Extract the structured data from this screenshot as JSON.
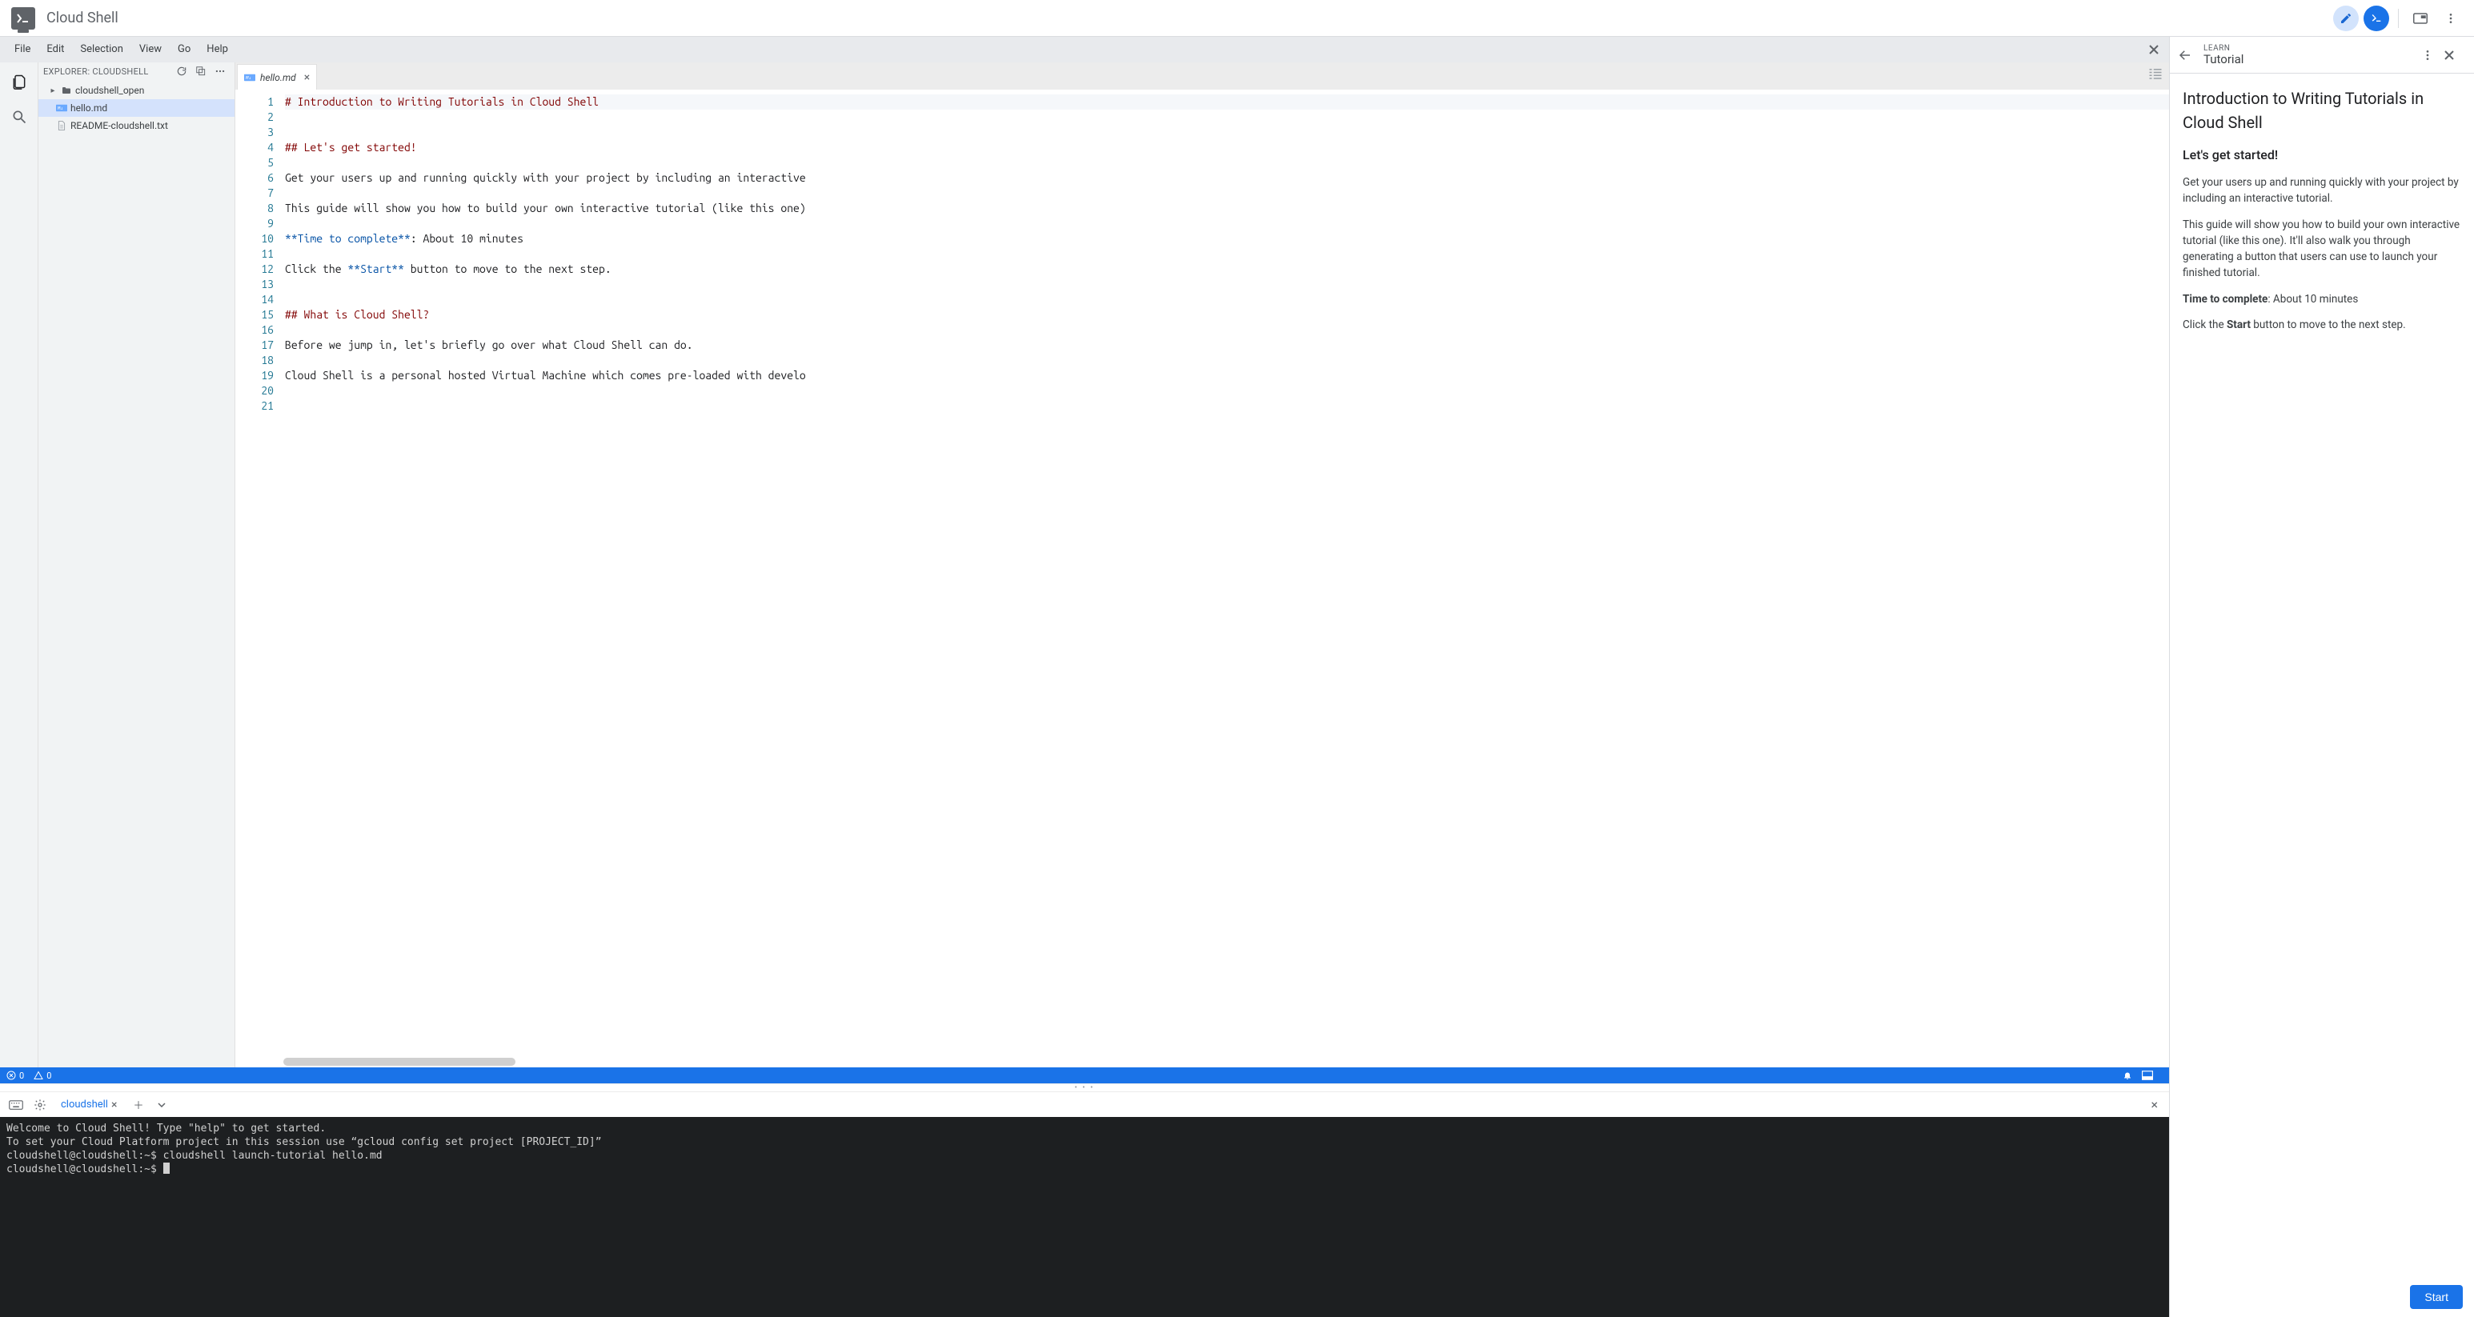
{
  "topbar": {
    "title": "Cloud Shell",
    "buttons": {
      "edit": "pencil-icon",
      "terminal": "terminal-icon",
      "window": "open-new-window-icon",
      "more": "more-vert-icon"
    }
  },
  "menubar": {
    "items": [
      "File",
      "Edit",
      "Selection",
      "View",
      "Go",
      "Help"
    ]
  },
  "explorer": {
    "header": "EXPLORER: CLOUDSHELL",
    "actions": {
      "refresh": "refresh",
      "collapse": "collapse-all",
      "more": "more"
    },
    "tree": [
      {
        "name": "cloudshell_open",
        "type": "folder",
        "depth": 0
      },
      {
        "name": "hello.md",
        "type": "md",
        "depth": 1,
        "selected": true
      },
      {
        "name": "README-cloudshell.txt",
        "type": "txt",
        "depth": 1
      }
    ]
  },
  "editor": {
    "active_tab": "hello.md",
    "lines": [
      {
        "type": "h1",
        "text": "# Introduction to Writing Tutorials in Cloud Shell"
      },
      {
        "type": "blank",
        "text": ""
      },
      {
        "type": "blank",
        "text": ""
      },
      {
        "type": "h2",
        "text": "## Let's get started!"
      },
      {
        "type": "blank",
        "text": ""
      },
      {
        "type": "text",
        "text": "Get your users up and running quickly with your project by including an interactive"
      },
      {
        "type": "blank",
        "text": ""
      },
      {
        "type": "text",
        "text": "This guide will show you how to build your own interactive tutorial (like this one)"
      },
      {
        "type": "blank",
        "text": ""
      },
      {
        "type": "mixed",
        "prefix_bold": "**Time to complete**",
        "suffix": ": About 10 minutes"
      },
      {
        "type": "blank",
        "text": ""
      },
      {
        "type": "mixed2",
        "prefix": "Click the ",
        "bold": "**Start**",
        "suffix": " button to move to the next step."
      },
      {
        "type": "blank",
        "text": ""
      },
      {
        "type": "blank",
        "text": ""
      },
      {
        "type": "h2",
        "text": "## What is Cloud Shell?"
      },
      {
        "type": "blank",
        "text": ""
      },
      {
        "type": "text",
        "text": "Before we jump in, let's briefly go over what Cloud Shell can do."
      },
      {
        "type": "blank",
        "text": ""
      },
      {
        "type": "text",
        "text": "Cloud Shell is a personal hosted Virtual Machine which comes pre-loaded with develo"
      },
      {
        "type": "blank",
        "text": ""
      },
      {
        "type": "blank",
        "text": ""
      }
    ]
  },
  "statusbar": {
    "errors": "0",
    "warnings": "0"
  },
  "terminal": {
    "tab": "cloudshell",
    "lines": [
      "Welcome to Cloud Shell! Type \"help\" to get started.",
      "To set your Cloud Platform project in this session use “gcloud config set project [PROJECT_ID]”",
      "cloudshell@cloudshell:~$ cloudshell launch-tutorial hello.md",
      "cloudshell@cloudshell:~$ "
    ]
  },
  "tutorial": {
    "overline": "LEARN",
    "label": "Tutorial",
    "title": "Introduction to Writing Tutorials in Cloud Shell",
    "subtitle": "Let's get started!",
    "p1": "Get your users up and running quickly with your project by including an interactive tutorial.",
    "p2": "This guide will show you how to build your own interactive tutorial (like this one). It'll also walk you through generating a button that users can use to launch your finished tutorial.",
    "time_label": "Time to complete",
    "time_value": ": About 10 minutes",
    "cta_prefix": "Click the ",
    "cta_bold": "Start",
    "cta_suffix": " button to move to the next step.",
    "start": "Start"
  }
}
